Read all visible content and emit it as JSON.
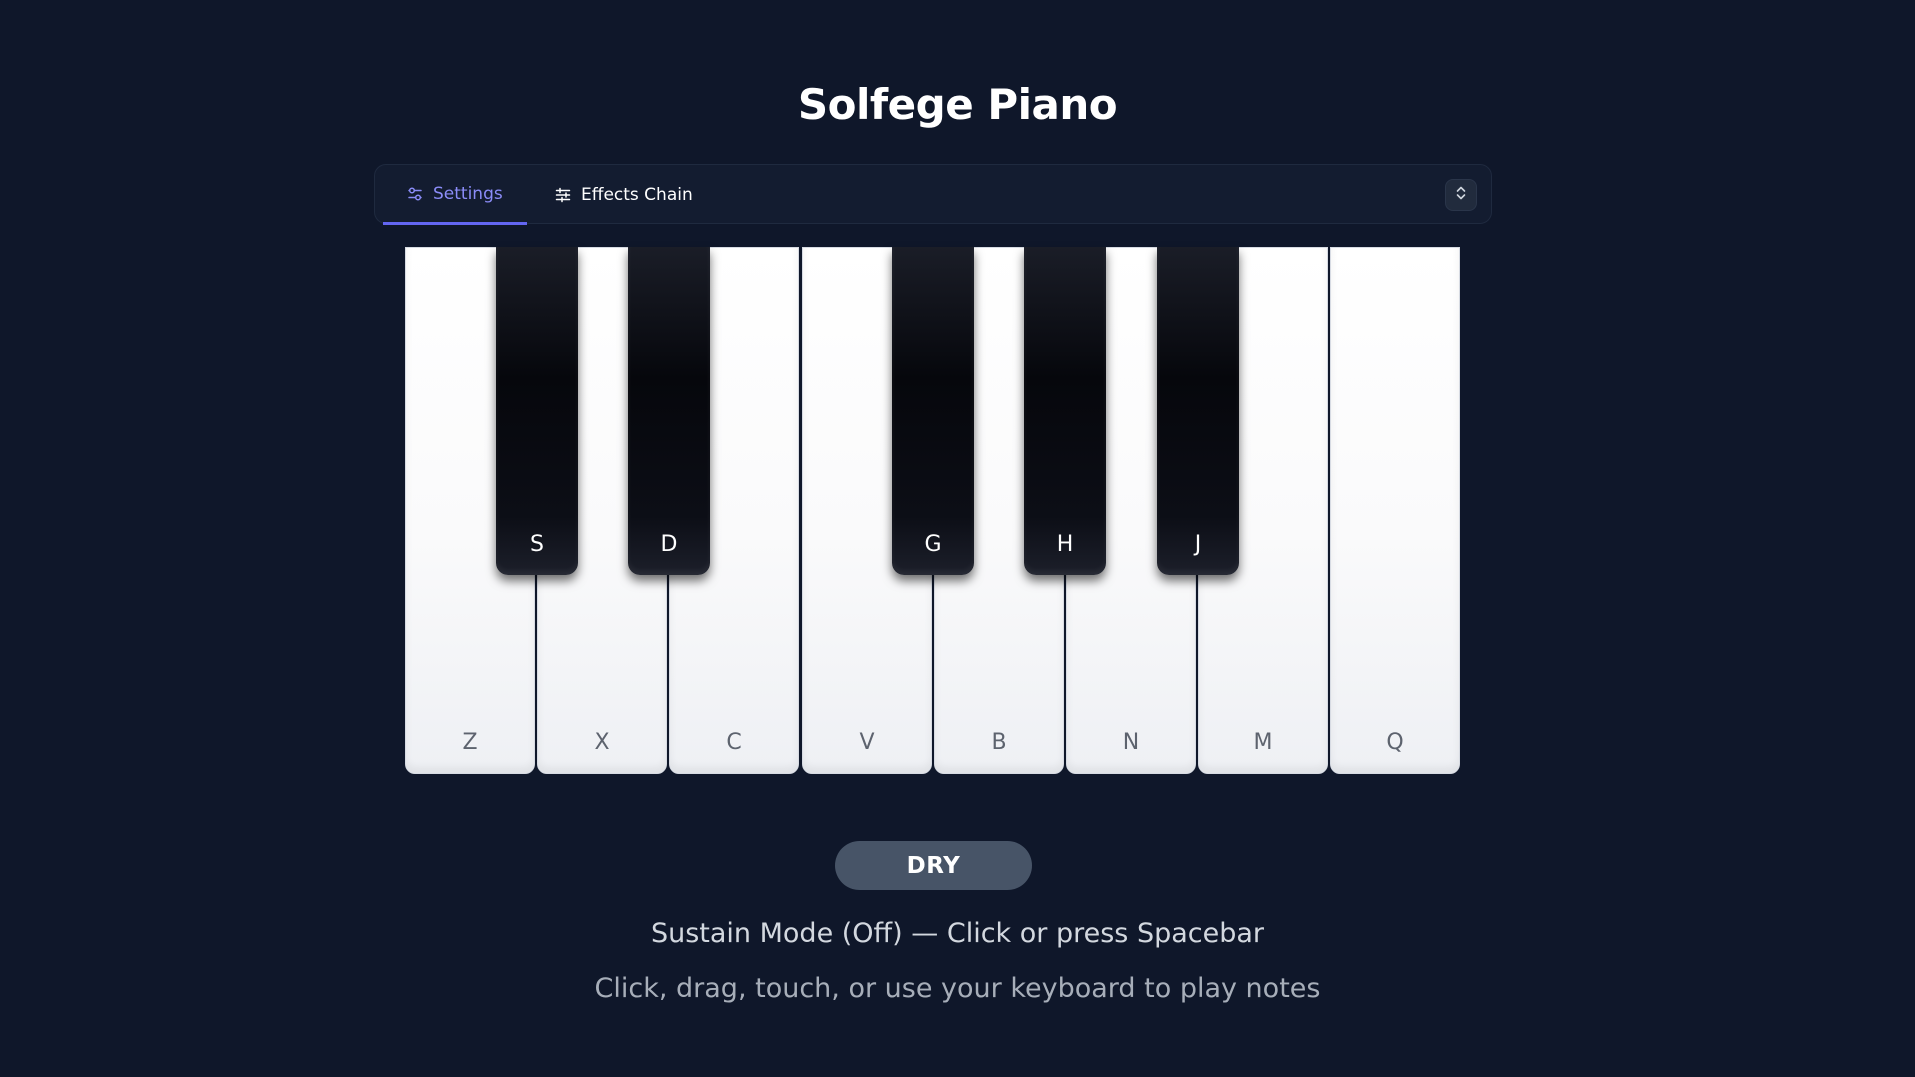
{
  "app": {
    "title": "Solfege Piano"
  },
  "toolbar": {
    "tabs": [
      {
        "label": "Settings",
        "icon": "sliders-icon",
        "active": true
      },
      {
        "label": "Effects Chain",
        "icon": "equalizer-icon",
        "active": false
      }
    ],
    "collapse_icon": "chevron-up-down-icon"
  },
  "piano": {
    "white_keys": [
      "Z",
      "X",
      "C",
      "V",
      "B",
      "N",
      "M",
      "Q"
    ],
    "black_keys": [
      "S",
      "D",
      "G",
      "H",
      "J"
    ]
  },
  "status": {
    "mode_badge": "DRY",
    "sustain": "Sustain Mode (Off) — Click or press Spacebar",
    "hint": "Click, drag, touch, or use your keyboard to play notes"
  },
  "colors": {
    "background": "#0f172a",
    "accent": "#6366f1",
    "badge": "#475467"
  }
}
